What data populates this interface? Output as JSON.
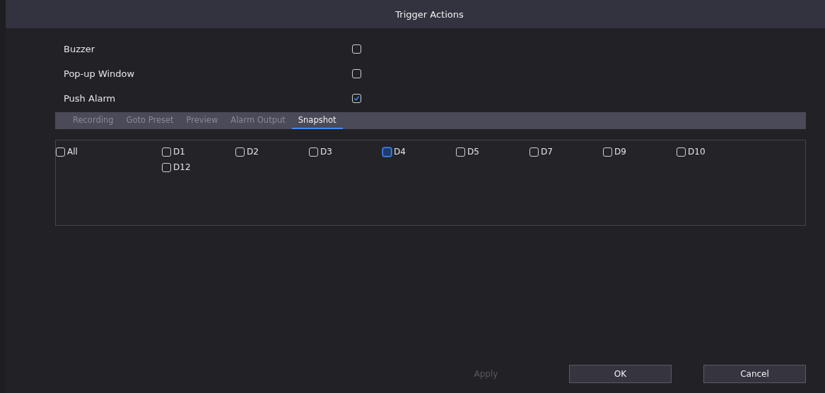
{
  "window": {
    "title": "Trigger Actions"
  },
  "options": [
    {
      "label": "Buzzer",
      "checked": false
    },
    {
      "label": "Pop-up Window",
      "checked": false
    },
    {
      "label": "Push Alarm",
      "checked": true
    }
  ],
  "tabs": [
    {
      "label": "Recording",
      "selected": false
    },
    {
      "label": "Goto Preset",
      "selected": false
    },
    {
      "label": "Preview",
      "selected": false
    },
    {
      "label": "Alarm Output",
      "selected": false
    },
    {
      "label": "Snapshot",
      "selected": true
    }
  ],
  "all": {
    "label": "All",
    "checked": false
  },
  "channels": [
    {
      "label": "D1",
      "checked": false,
      "focused": false
    },
    {
      "label": "D2",
      "checked": false,
      "focused": false
    },
    {
      "label": "D3",
      "checked": false,
      "focused": false
    },
    {
      "label": "D4",
      "checked": false,
      "focused": true
    },
    {
      "label": "D5",
      "checked": false,
      "focused": false
    },
    {
      "label": "D7",
      "checked": false,
      "focused": false
    },
    {
      "label": "D9",
      "checked": false,
      "focused": false
    },
    {
      "label": "D10",
      "checked": false,
      "focused": false
    },
    {
      "label": "D12",
      "checked": false,
      "focused": false
    }
  ],
  "buttons": [
    {
      "label": "Apply",
      "disabled": true
    },
    {
      "label": "OK",
      "disabled": false
    },
    {
      "label": "Cancel",
      "disabled": false
    }
  ]
}
